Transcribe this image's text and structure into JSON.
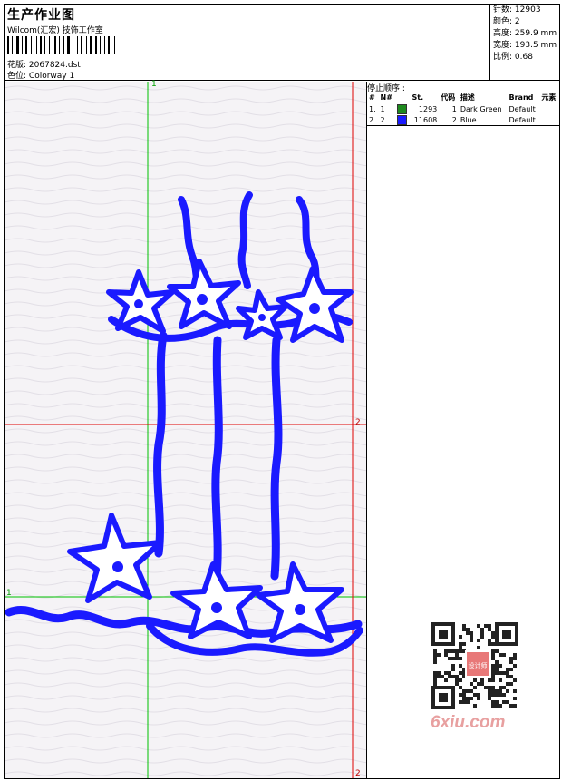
{
  "header": {
    "title": "生产作业图",
    "company": "Wilcom(汇宏) 技饰工作室",
    "design_label": "花版:",
    "design_value": "2067824.dst",
    "colorway_label": "色位:",
    "colorway_value": "Colorway 1"
  },
  "stats": {
    "stitches_label": "针数:",
    "stitches_value": "12903",
    "colors_label": "颜色:",
    "colors_value": "2",
    "height_label": "高度:",
    "height_value": "259.9 mm",
    "width_label": "宽度:",
    "width_value": "193.5 mm",
    "scale_label": "比例:",
    "scale_value": "0.68"
  },
  "stop_sequence": {
    "title": "停止顺序 :",
    "headers": [
      "#",
      "N#",
      "St.",
      "代码",
      "描述",
      "Brand",
      "元素"
    ],
    "rows": [
      {
        "index": "1.",
        "n": "1",
        "color": "#1e8a1e",
        "stitches": "1293",
        "code": "1",
        "desc": "Dark Green",
        "brand": "Default"
      },
      {
        "index": "2.",
        "n": "2",
        "color": "#1a1aff",
        "stitches": "11608",
        "code": "2",
        "desc": "Blue",
        "brand": "Default"
      }
    ]
  },
  "markers": {
    "green_top": "1",
    "green_left": "1",
    "red_right_mid": "2",
    "red_right_bottom": "2"
  },
  "watermark": {
    "text": "6xiu.com",
    "qr_center": "设计师"
  },
  "colors": {
    "embroidery": "#1a1aff",
    "guide_green": "#00c000",
    "guide_red": "#e00000"
  }
}
